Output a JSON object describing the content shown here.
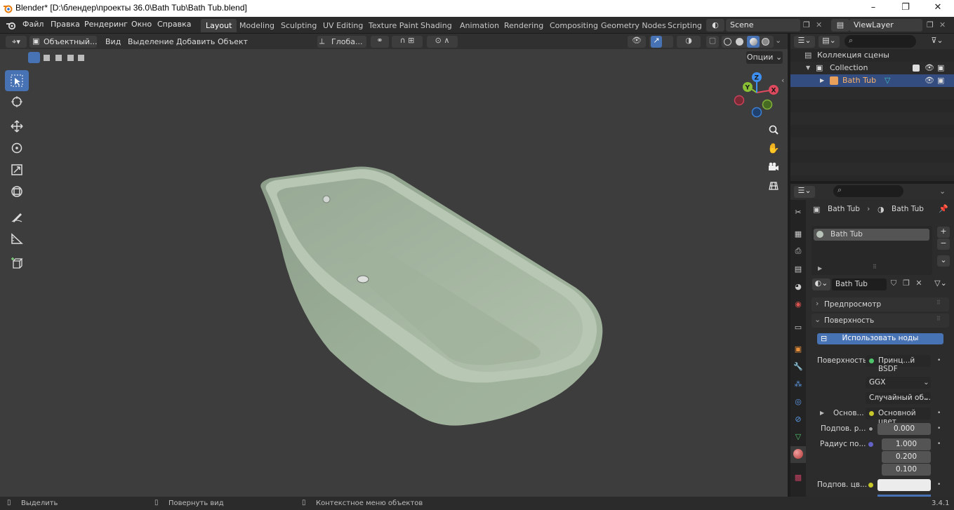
{
  "window": {
    "title": "Blender* [D:\\блендер\\проекты 36.0\\Bath Tub\\Bath Tub.blend]"
  },
  "menu": [
    "Файл",
    "Правка",
    "Рендеринг",
    "Окно",
    "Справка"
  ],
  "workspaces": [
    "Layout",
    "Modeling",
    "Sculpting",
    "UV Editing",
    "Texture Paint",
    "Shading",
    "Animation",
    "Rendering",
    "Compositing",
    "Geometry Nodes",
    "Scripting"
  ],
  "scene": {
    "name": "Scene",
    "view_layer": "ViewLayer"
  },
  "viewport_header": {
    "mode": "Объектный...",
    "menus": [
      "Вид",
      "Выделение",
      "Добавить",
      "Объект"
    ],
    "orientation": "Глоба...",
    "options": "Опции"
  },
  "gizmo": {
    "x": "X",
    "y": "Y",
    "z": "Z"
  },
  "outliner": {
    "root": "Коллекция сцены",
    "collection": "Collection",
    "object": "Bath Tub"
  },
  "properties": {
    "breadcrumb": [
      "Bath Tub",
      "Bath Tub"
    ],
    "slot": "Bath Tub",
    "material": "Bath Tub",
    "sections": {
      "preview": "Предпросмотр",
      "surface": "Поверхность"
    },
    "use_nodes": "Использовать ноды",
    "surface_label": "Поверхность",
    "shader": "Принц...й BSDF",
    "distribution": "GGX",
    "subsurface_method": "Случайный об...",
    "base_label": "Основ...",
    "base_value": "Основной цвет",
    "subsurface_label": "Подпов. р...",
    "subsurface_value": "0.000",
    "radius_label": "Радиус по...",
    "radius_values": [
      "1.000",
      "0.200",
      "0.100"
    ],
    "subsurface_color_label": "Подпов. цв..."
  },
  "status": {
    "left": "Выделить",
    "middle": "Повернуть вид",
    "right": "Контекстное меню объектов",
    "version": "3.4.1"
  },
  "colors": {
    "accent": "#4772b3",
    "x_axis": "#e04a5f",
    "y_axis": "#8ac035",
    "z_axis": "#3d8ff1"
  }
}
